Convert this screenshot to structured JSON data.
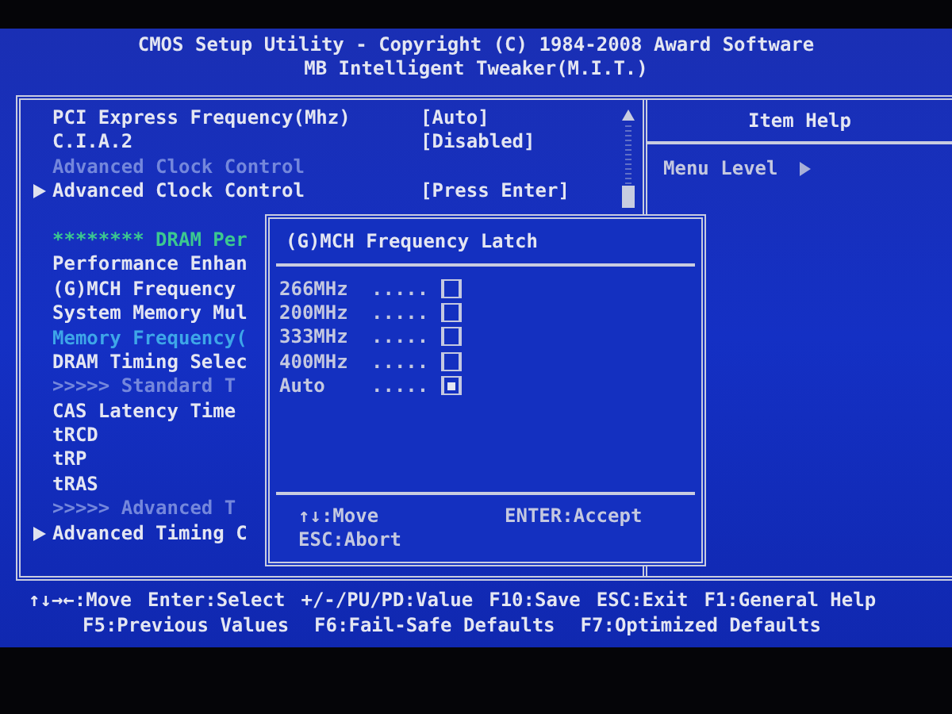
{
  "header": {
    "title": "CMOS Setup Utility - Copyright (C) 1984-2008 Award Software",
    "subtitle": "MB Intelligent Tweaker(M.I.T.)"
  },
  "settings": [
    {
      "kind": "item",
      "label": "PCI Express Frequency(Mhz)",
      "value": "[Auto]"
    },
    {
      "kind": "item",
      "label": "C.I.A.2",
      "value": "[Disabled]"
    },
    {
      "kind": "dim",
      "label": "Advanced Clock Control"
    },
    {
      "kind": "submenu",
      "label": "Advanced Clock Control",
      "value": "[Press Enter]"
    },
    {
      "kind": "section",
      "label": "******** DRAM Per"
    },
    {
      "kind": "item",
      "label": "Performance Enhan"
    },
    {
      "kind": "item",
      "label": "(G)MCH Frequency"
    },
    {
      "kind": "item",
      "label": "System Memory Mul"
    },
    {
      "kind": "highlight",
      "label": "Memory Frequency("
    },
    {
      "kind": "item",
      "label": "DRAM Timing Selec"
    },
    {
      "kind": "dim",
      "label": ">>>>>  Standard T"
    },
    {
      "kind": "item",
      "label": "CAS Latency Time"
    },
    {
      "kind": "item",
      "label": "tRCD"
    },
    {
      "kind": "item",
      "label": "tRP"
    },
    {
      "kind": "item",
      "label": "tRAS"
    },
    {
      "kind": "dim",
      "label": ">>>>>  Advanced T"
    },
    {
      "kind": "submenu",
      "label": "Advanced Timing C"
    }
  ],
  "help": {
    "title": "Item Help",
    "menu_level": "Menu Level"
  },
  "popup": {
    "title": "(G)MCH Frequency Latch",
    "options": [
      {
        "label": "266MHz",
        "dots": ".....",
        "selected": false
      },
      {
        "label": "200MHz",
        "dots": ".....",
        "selected": false
      },
      {
        "label": "333MHz",
        "dots": ".....",
        "selected": false
      },
      {
        "label": "400MHz",
        "dots": ".....",
        "selected": false
      },
      {
        "label": "Auto",
        "dots": ".....",
        "selected": true
      }
    ],
    "keys": [
      "↑↓:Move",
      "ENTER:Accept",
      "ESC:Abort"
    ]
  },
  "footer": [
    [
      "↑↓→←:Move",
      "Enter:Select",
      "+/-/PU/PD:Value",
      "F10:Save",
      "ESC:Exit",
      "F1:General Help"
    ],
    [
      "F5:Previous Values",
      "F6:Fail-Safe Defaults",
      "F7:Optimized Defaults"
    ]
  ]
}
